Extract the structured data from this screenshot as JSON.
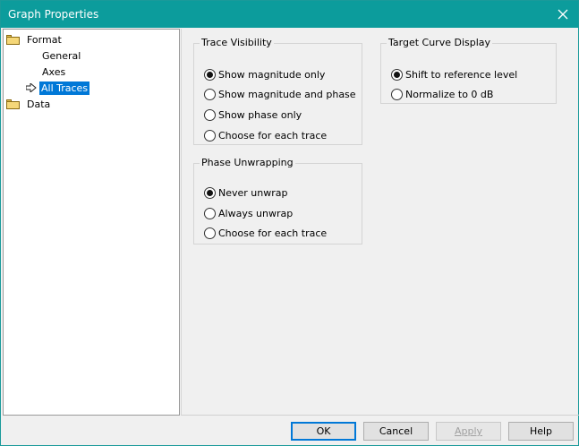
{
  "window": {
    "title": "Graph Properties"
  },
  "tree": {
    "format": "Format",
    "general": "General",
    "axes": "Axes",
    "all_traces": "All Traces",
    "data": "Data"
  },
  "trace_visibility": {
    "legend": "Trace Visibility",
    "options": [
      "Show magnitude only",
      "Show magnitude and phase",
      "Show phase only",
      "Choose for each trace"
    ],
    "selected": "Show magnitude only"
  },
  "phase_unwrapping": {
    "legend": "Phase Unwrapping",
    "options": [
      "Never unwrap",
      "Always unwrap",
      "Choose for each trace"
    ],
    "selected": "Never unwrap"
  },
  "target_curve": {
    "legend": "Target Curve Display",
    "options": [
      "Shift to reference level",
      "Normalize to 0 dB"
    ],
    "selected": "Shift to reference level"
  },
  "buttons": {
    "ok": "OK",
    "cancel": "Cancel",
    "apply": "Apply",
    "help": "Help"
  },
  "colors": {
    "titlebar": "#0c9c9c",
    "selection": "#0078d7"
  }
}
